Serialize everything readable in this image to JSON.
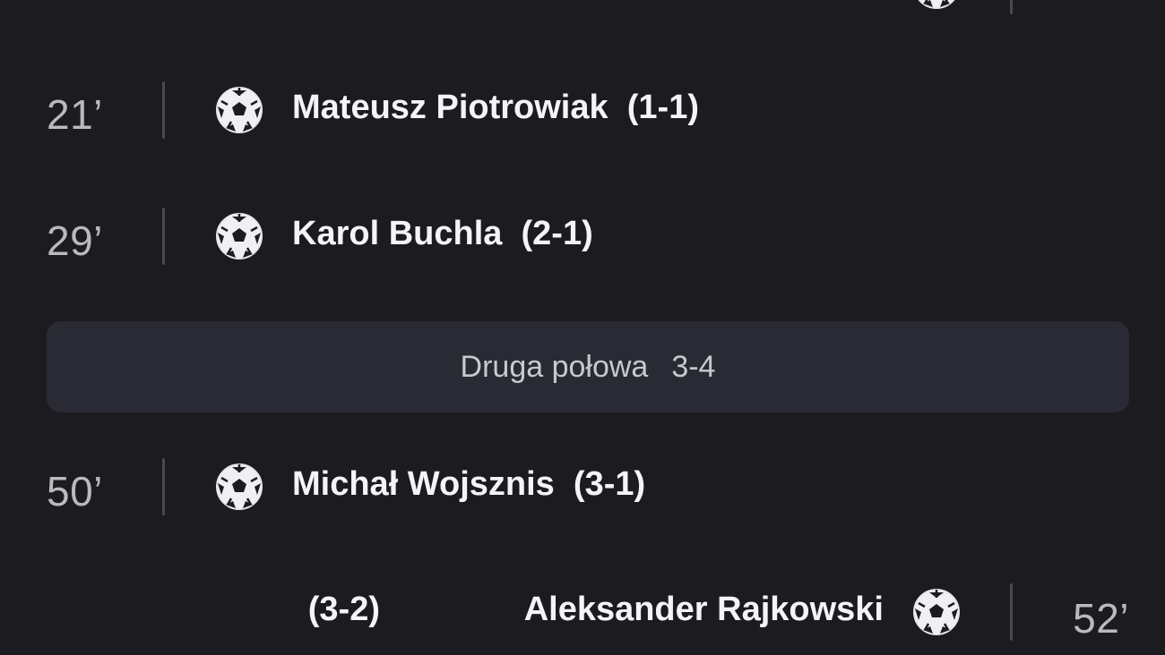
{
  "events": [
    {
      "side": "away",
      "minute": "",
      "player": "",
      "score": ""
    },
    {
      "side": "home",
      "minute": "21’",
      "player": "Mateusz Piotrowiak",
      "score": "(1-1)"
    },
    {
      "side": "home",
      "minute": "29’",
      "player": "Karol Buchla",
      "score": "(2-1)"
    },
    {
      "side": "home",
      "minute": "50’",
      "player": "Michał Wojsznis",
      "score": "(3-1)"
    },
    {
      "side": "away",
      "minute": "52’",
      "player": "Aleksander Rajkowski",
      "score": "(3-2)"
    }
  ],
  "half_divider": {
    "label": "Druga połowa",
    "score": "3-4"
  },
  "icons": {
    "goal": "soccer-ball-icon"
  },
  "colors": {
    "background": "#1c1b20",
    "divider_bar": "#2a2a35",
    "minute_text": "#b9b9bf",
    "player_text": "#f4f4f6"
  }
}
